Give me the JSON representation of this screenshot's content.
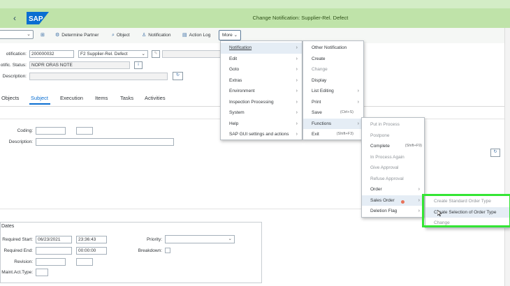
{
  "shell": {
    "back": "‹",
    "logo": "SAP",
    "title": "Change Notification: Supplier-Rel. Defect"
  },
  "toolbar": {
    "determine_partner": "Determine Partner",
    "object": "Object",
    "notification": "Notification",
    "action_log": "Action Log",
    "more": "More"
  },
  "header": {
    "notification_label": "otification:",
    "notification_value": "200000032",
    "type_value": "F2 Supplier-Rel. Defect",
    "status_label": "otific. Status:",
    "status_value": "NOPR ORAS NOTE",
    "description_label": "Description:",
    "description_value": ""
  },
  "tabs": [
    "Objects",
    "Subject",
    "Execution",
    "Items",
    "Tasks",
    "Activities"
  ],
  "subject": {
    "coding_label": "Coding:",
    "description_label": "Description:"
  },
  "dates": {
    "title": "Dates",
    "req_start_label": "Required Start:",
    "req_start_date": "06/23/2021",
    "req_start_time": "23:36:43",
    "req_end_label": "Required End:",
    "req_end_time": "00:00:00",
    "revision_label": "Revision:",
    "maint_label": "Maint.Act.Type:",
    "priority_label": "Priority:",
    "breakdown_label": "Breakdown:"
  },
  "menu_main": [
    {
      "label": "Notification",
      "arrow": "›"
    },
    {
      "label": "Edit",
      "arrow": "›"
    },
    {
      "label": "Goto",
      "arrow": "›"
    },
    {
      "label": "Extras",
      "arrow": "›"
    },
    {
      "label": "Environment",
      "arrow": "›"
    },
    {
      "label": "Inspection Processing",
      "arrow": "›"
    },
    {
      "label": "System",
      "arrow": "›"
    },
    {
      "label": "Help",
      "arrow": "›"
    },
    {
      "label": "SAP GUI settings and actions",
      "arrow": "›"
    }
  ],
  "menu_notification": [
    {
      "label": "Other Notification"
    },
    {
      "label": "Create"
    },
    {
      "label": "Change"
    },
    {
      "label": "Display"
    },
    {
      "label": "List Editing",
      "arrow": "›"
    },
    {
      "label": "Print",
      "arrow": "›"
    },
    {
      "label": "Save",
      "shortcut": "(Ctrl+S)"
    },
    {
      "label": "Functions",
      "arrow": "›"
    },
    {
      "label": "Exit",
      "shortcut": "(Shift+F3)"
    }
  ],
  "menu_functions": [
    {
      "label": "Put in Process"
    },
    {
      "label": "Postpone"
    },
    {
      "label": "Complete",
      "shortcut": "(Shift+F9)"
    },
    {
      "label": "In Process Again"
    },
    {
      "label": "Give Approval"
    },
    {
      "label": "Refuse Approval"
    },
    {
      "label": "Order",
      "arrow": "›"
    },
    {
      "label": "Sales Order",
      "arrow": "›"
    },
    {
      "label": "Deletion Flag",
      "arrow": "›"
    }
  ],
  "menu_sales_order": [
    {
      "label": "Create Standard Order Type"
    },
    {
      "label": "Create Selection of Order Type"
    },
    {
      "label": "Change"
    }
  ],
  "colors": {
    "shellbar": "#bfe3a9",
    "accent": "#0a6ed1",
    "highlight": "#34e534"
  }
}
